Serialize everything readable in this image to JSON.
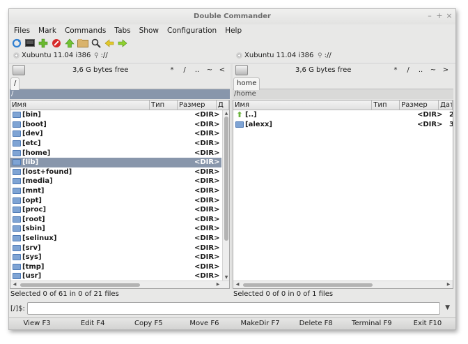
{
  "window": {
    "title": "Double Commander"
  },
  "menu": [
    "Files",
    "Mark",
    "Commands",
    "Tabs",
    "Show",
    "Configuration",
    "Help"
  ],
  "toolbar": [
    "refresh-icon",
    "terminal-icon",
    "add-icon",
    "stop-icon",
    "home-icon",
    "folder-icon",
    "search-icon",
    "back-icon",
    "forward-icon"
  ],
  "left": {
    "drive_label": "Xubuntu 11.04 i386",
    "net_label": "://",
    "free_space": "3,6 G bytes free",
    "nav": [
      "*",
      "/",
      "..",
      "~",
      "<"
    ],
    "tab": "/",
    "path": "/",
    "columns": [
      "Имя",
      "Тип",
      "Размер",
      "Д"
    ],
    "files": [
      {
        "name": "[bin]",
        "size": "<DIR>"
      },
      {
        "name": "[boot]",
        "size": "<DIR>"
      },
      {
        "name": "[dev]",
        "size": "<DIR>"
      },
      {
        "name": "[etc]",
        "size": "<DIR>"
      },
      {
        "name": "[home]",
        "size": "<DIR>"
      },
      {
        "name": "[lib]",
        "size": "<DIR>",
        "selected": true
      },
      {
        "name": "[lost+found]",
        "size": "<DIR>"
      },
      {
        "name": "[media]",
        "size": "<DIR>"
      },
      {
        "name": "[mnt]",
        "size": "<DIR>"
      },
      {
        "name": "[opt]",
        "size": "<DIR>"
      },
      {
        "name": "[proc]",
        "size": "<DIR>"
      },
      {
        "name": "[root]",
        "size": "<DIR>"
      },
      {
        "name": "[sbin]",
        "size": "<DIR>"
      },
      {
        "name": "[selinux]",
        "size": "<DIR>"
      },
      {
        "name": "[srv]",
        "size": "<DIR>"
      },
      {
        "name": "[sys]",
        "size": "<DIR>"
      },
      {
        "name": "[tmp]",
        "size": "<DIR>"
      },
      {
        "name": "[usr]",
        "size": "<DIR>"
      }
    ],
    "status": "Selected 0 of 61 in 0 of 21 files"
  },
  "right": {
    "drive_label": "Xubuntu 11.04 i386",
    "net_label": "://",
    "free_space": "3,6 G bytes free",
    "nav": [
      "*",
      "/",
      "..",
      "~",
      ">"
    ],
    "tab": "home",
    "path": "/home",
    "columns": [
      "Имя",
      "Тип",
      "Размер",
      "Дат"
    ],
    "files": [
      {
        "name": "[..]",
        "size": "<DIR>",
        "date": "2",
        "up": true
      },
      {
        "name": "[alexx]",
        "size": "<DIR>",
        "date": "3"
      }
    ],
    "status": "Selected 0 of 0 in 0 of 1 files"
  },
  "cmdline": {
    "prompt": "[/]$:",
    "value": ""
  },
  "fkeys": [
    "View F3",
    "Edit F4",
    "Copy F5",
    "Move F6",
    "MakeDir F7",
    "Delete F8",
    "Terminal F9",
    "Exit F10"
  ],
  "colors": {
    "selection": "#8896ab",
    "folder": "#7fa4d4"
  }
}
